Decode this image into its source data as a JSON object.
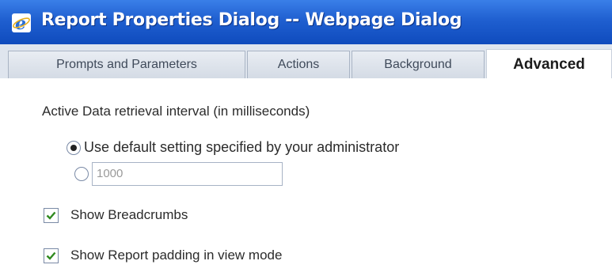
{
  "window": {
    "title": "Report Properties Dialog -- Webpage Dialog",
    "icon": "internet-explorer-icon"
  },
  "tabs": [
    {
      "label": "Prompts and Parameters",
      "active": false
    },
    {
      "label": "Actions",
      "active": false
    },
    {
      "label": "Background",
      "active": false
    },
    {
      "label": "Advanced",
      "active": true
    }
  ],
  "advanced": {
    "interval_label": "Active Data retrieval interval (in milliseconds)",
    "option_default_label": "Use default setting specified by your administrator",
    "option_default_selected": true,
    "option_custom_selected": false,
    "custom_interval_value": "1000",
    "show_breadcrumbs_label": "Show Breadcrumbs",
    "show_breadcrumbs_checked": true,
    "show_padding_label": "Show Report padding in view mode",
    "show_padding_checked": true
  },
  "colors": {
    "titlebar": "#1f5fd0",
    "tab_inactive": "#dfe5ee",
    "check_mark": "#2f8a1f"
  }
}
